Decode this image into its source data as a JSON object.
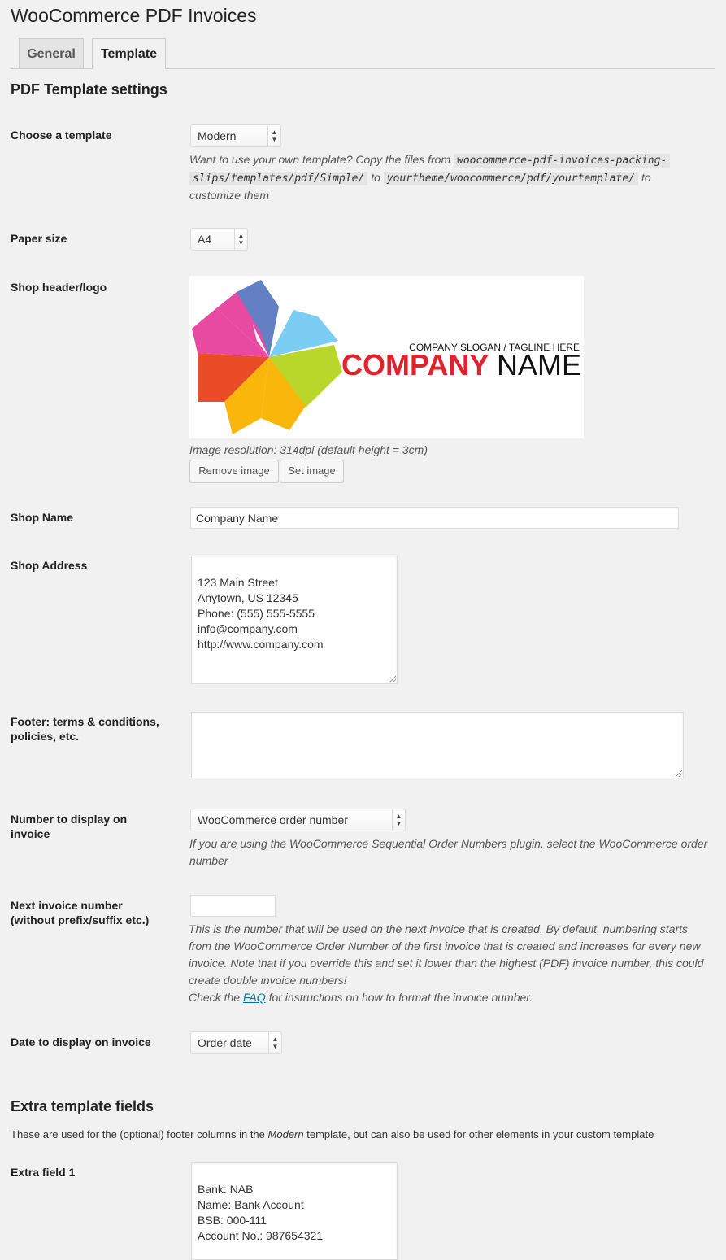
{
  "page": {
    "title": "WooCommerce PDF Invoices"
  },
  "tabs": [
    {
      "label": "General",
      "active": false
    },
    {
      "label": "Template",
      "active": true
    }
  ],
  "pdf_section": {
    "title": "PDF Template settings"
  },
  "template": {
    "label": "Choose a template",
    "value": "Modern",
    "desc_pre": "Want to use your own template? Copy the files from",
    "path_from_1": "woocommerce-pdf-invoices-packing-",
    "path_from_2": "slips/templates/pdf/Simple/",
    "desc_to": "to",
    "path_to": "yourtheme/woocommerce/pdf/yourtemplate/",
    "desc_to2": "to",
    "desc_post": "customize them"
  },
  "paper": {
    "label": "Paper size",
    "value": "A4"
  },
  "logo": {
    "label": "Shop header/logo",
    "slogan": "COMPANY SLOGAN / TAGLINE HERE",
    "company_word": "COMPANY",
    "name_word": "NAME",
    "resolution": "Image resolution: 314dpi (default height = 3cm)",
    "remove_label": "Remove image",
    "set_label": "Set image",
    "colors": {
      "red": "#e0222d",
      "blue": "#6280c3",
      "magenta": "#e84aa1",
      "cyan": "#7ccdf3",
      "green": "#b9d62a",
      "yellow": "#fbb60c",
      "orange": "#ea4c27"
    }
  },
  "shop_name": {
    "label": "Shop Name",
    "value": "Company Name"
  },
  "shop_address": {
    "label": "Shop Address",
    "value": "123 Main Street\nAnytown, US 12345\nPhone: (555) 555-5555\ninfo@company.com\nhttp://www.company.com"
  },
  "footer": {
    "label_1": "Footer: terms & conditions,",
    "label_2": "policies, etc.",
    "value": ""
  },
  "number_display": {
    "label_1": "Number to display on",
    "label_2": "invoice",
    "value": "WooCommerce order number",
    "desc_1": "If you are using the WooCommerce Sequential Order Numbers plugin, select the WooCommerce order",
    "desc_2": "number"
  },
  "next_invoice": {
    "label_1": "Next invoice number",
    "label_2": "(without prefix/suffix etc.)",
    "value": "",
    "desc_1": "This is the number that will be used on the next invoice that is created. By default, numbering starts",
    "desc_2": "from the WooCommerce Order Number of the first invoice that is created and increases for every new",
    "desc_3": "invoice. Note that if you override this and set it lower than the highest (PDF) invoice number, this could",
    "desc_4": "create double invoice numbers!",
    "faq_pre": "Check the",
    "faq_link": "FAQ",
    "faq_post": "for instructions on how to format the invoice number."
  },
  "date_display": {
    "label": "Date to display on invoice",
    "value": "Order date"
  },
  "extra_section": {
    "title": "Extra template fields",
    "desc_pre": "These are used for the (optional) footer columns in the",
    "desc_em": "Modern",
    "desc_post": "template, but can also be used for other elements in your custom template"
  },
  "extra_field_1": {
    "label": "Extra field 1",
    "value": "Bank: NAB\nName: Bank Account\nBSB: 000-111\nAccount No.: 987654321"
  }
}
